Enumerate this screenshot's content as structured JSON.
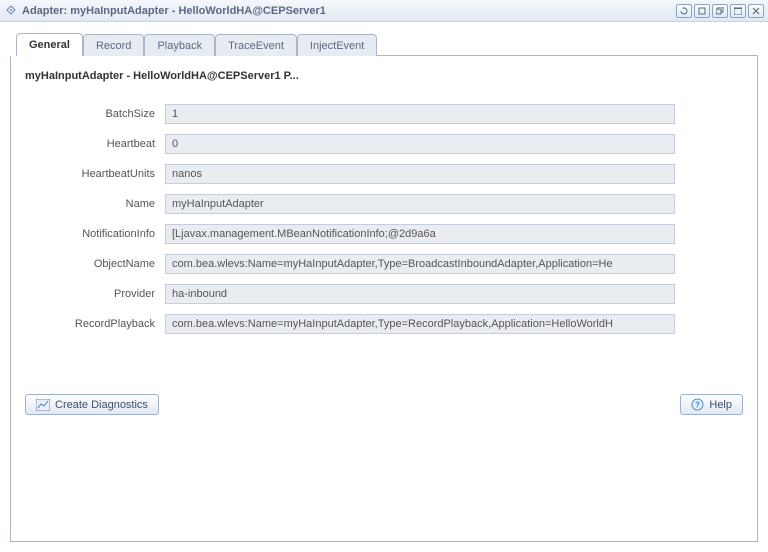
{
  "window": {
    "title": "Adapter: myHaInputAdapter - HelloWorldHA@CEPServer1"
  },
  "tabs": {
    "t0": "General",
    "t1": "Record",
    "t2": "Playback",
    "t3": "TraceEvent",
    "t4": "InjectEvent"
  },
  "panel": {
    "title": "myHaInputAdapter - HelloWorldHA@CEPServer1 P..."
  },
  "labels": {
    "batchSize": "BatchSize",
    "heartbeat": "Heartbeat",
    "heartbeatUnits": "HeartbeatUnits",
    "name": "Name",
    "notificationInfo": "NotificationInfo",
    "objectName": "ObjectName",
    "provider": "Provider",
    "recordPlayback": "RecordPlayback"
  },
  "values": {
    "batchSize": "1",
    "heartbeat": "0",
    "heartbeatUnits": "nanos",
    "name": "myHaInputAdapter",
    "notificationInfo": "[Ljavax.management.MBeanNotificationInfo;@2d9a6a",
    "objectName": "com.bea.wlevs:Name=myHaInputAdapter,Type=BroadcastInboundAdapter,Application=He",
    "provider": "ha-inbound",
    "recordPlayback": "com.bea.wlevs:Name=myHaInputAdapter,Type=RecordPlayback,Application=HelloWorldH"
  },
  "buttons": {
    "createDiag": "Create Diagnostics",
    "help": "Help"
  }
}
